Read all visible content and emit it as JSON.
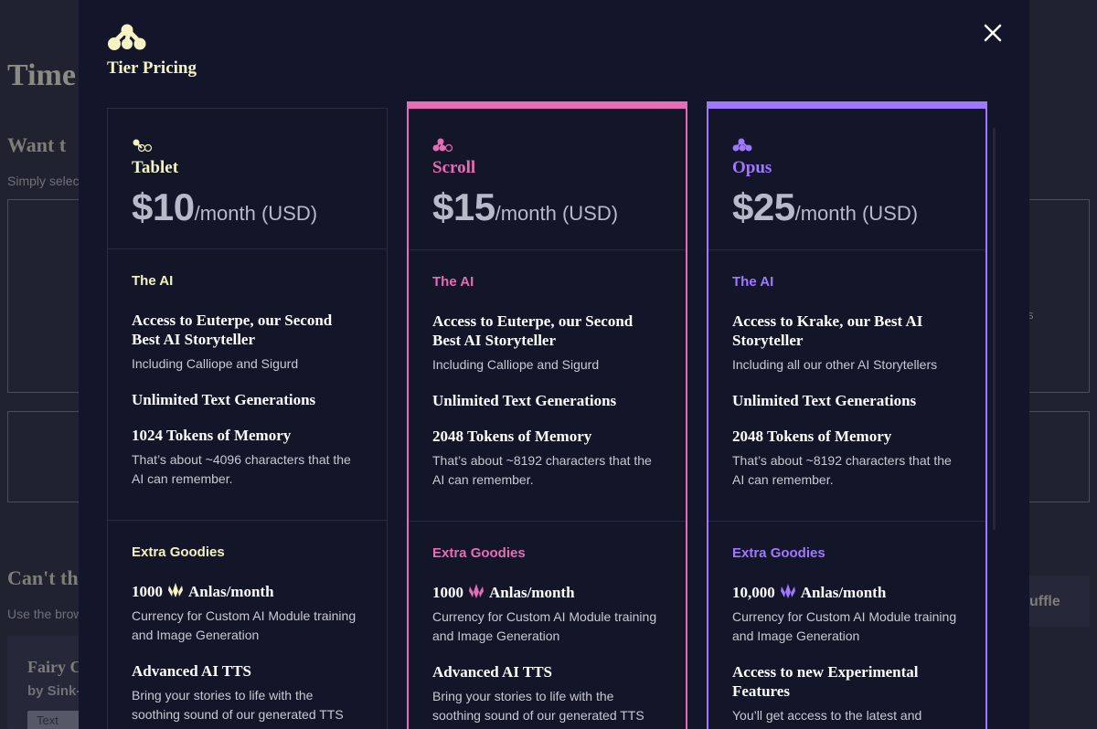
{
  "background": {
    "title": "Time",
    "heading1": "Want t",
    "subtext1": "Simply select",
    "heading2": "Can't th",
    "subtext2": "Use the brow",
    "card_title": "Fairy C",
    "card_by": "by Sink-",
    "card_tag": "Text Ad",
    "right_button": "uffle",
    "right_text": "s"
  },
  "modal": {
    "title": "Tier Pricing"
  },
  "tiers": [
    {
      "name": "Tablet",
      "price": "$10",
      "period": "/month (USD)",
      "ai_label": "The AI",
      "ai_features": [
        {
          "title": "Access to Euterpe, our Second Best AI Storyteller",
          "desc": "Including Calliope and Sigurd"
        },
        {
          "title": "Unlimited Text Generations",
          "desc": ""
        },
        {
          "title": "1024 Tokens of Memory",
          "desc": "That’s about ~4096 characters that the AI can remember."
        }
      ],
      "extra_label": "Extra Goodies",
      "extra_features": [
        {
          "title_pre": "1000",
          "title_post": "Anlas/month",
          "desc": "Currency for Custom AI Module training and Image Generation"
        },
        {
          "title": "Advanced AI TTS",
          "desc": "Bring your stories to life with the soothing sound of our generated TTS"
        }
      ]
    },
    {
      "name": "Scroll",
      "price": "$15",
      "period": "/month (USD)",
      "ai_label": "The AI",
      "ai_features": [
        {
          "title": "Access to Euterpe, our Second Best AI Storyteller",
          "desc": "Including Calliope and Sigurd"
        },
        {
          "title": "Unlimited Text Generations",
          "desc": ""
        },
        {
          "title": "2048 Tokens of Memory",
          "desc": "That’s about ~8192 characters that the AI can remember."
        }
      ],
      "extra_label": "Extra Goodies",
      "extra_features": [
        {
          "title_pre": "1000",
          "title_post": "Anlas/month",
          "desc": "Currency for Custom AI Module training and Image Generation"
        },
        {
          "title": "Advanced AI TTS",
          "desc": "Bring your stories to life with the soothing sound of our generated TTS"
        }
      ]
    },
    {
      "name": "Opus",
      "price": "$25",
      "period": "/month (USD)",
      "ai_label": "The AI",
      "ai_features": [
        {
          "title": "Access to Krake, our Best AI Storyteller",
          "desc": "Including all our other AI Storytellers"
        },
        {
          "title": "Unlimited Text Generations",
          "desc": ""
        },
        {
          "title": "2048 Tokens of Memory",
          "desc": "That’s about ~8192 characters that the AI can remember."
        }
      ],
      "extra_label": "Extra Goodies",
      "extra_features": [
        {
          "title_pre": "10,000",
          "title_post": "Anlas/month",
          "desc": "Currency for Custom AI Module training and Image Generation"
        },
        {
          "title": "Access to new Experimental Features",
          "desc": "You’ll get access to the latest and coolest"
        }
      ]
    }
  ],
  "colors": {
    "tablet": "#f5f3c2",
    "scroll": "#e46db6",
    "opus": "#a077ff",
    "modal_bg": "#13152a"
  },
  "icons": {
    "logo": "novelai-logo-icon",
    "close": "close-icon",
    "tier": "tier-glyph-icon",
    "anlas": "anlas-crystal-icon"
  }
}
